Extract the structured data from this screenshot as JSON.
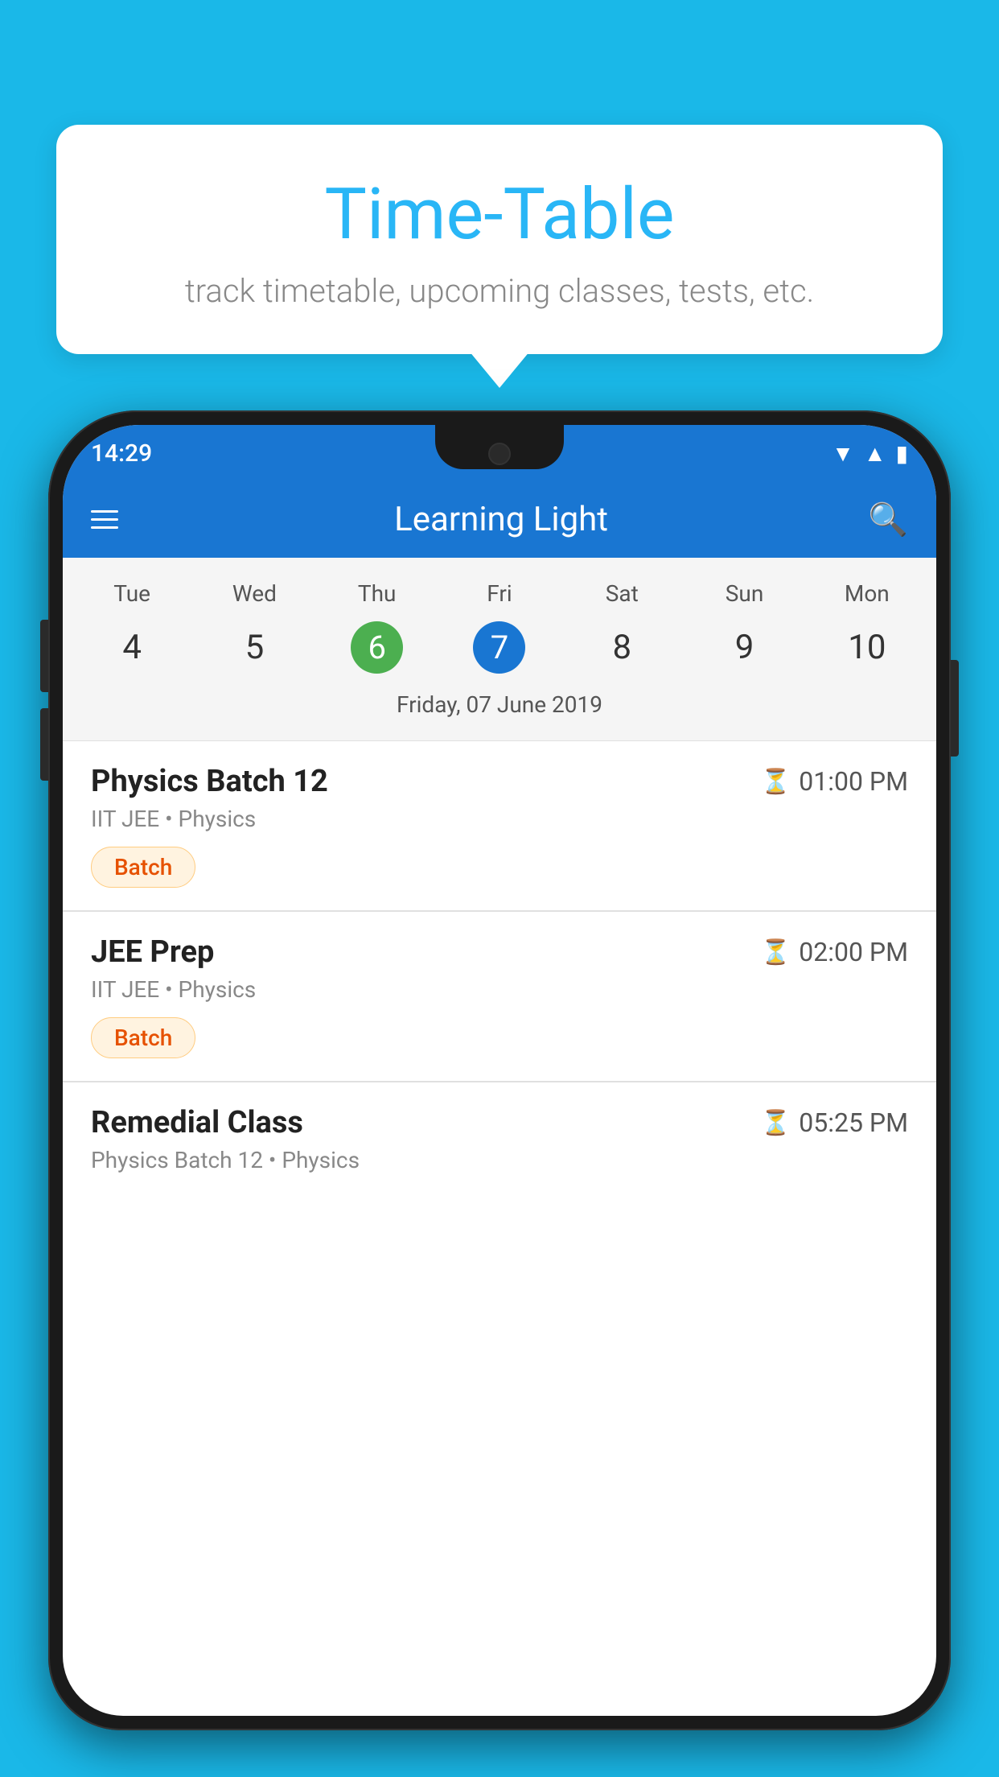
{
  "background_color": "#1ab8e8",
  "tooltip": {
    "title": "Time-Table",
    "subtitle": "track timetable, upcoming classes, tests, etc."
  },
  "phone": {
    "status_bar": {
      "time": "14:29"
    },
    "app_header": {
      "title": "Learning Light"
    },
    "calendar": {
      "days": [
        {
          "label": "Tue",
          "num": "4"
        },
        {
          "label": "Wed",
          "num": "5"
        },
        {
          "label": "Thu",
          "num": "6",
          "state": "today"
        },
        {
          "label": "Fri",
          "num": "7",
          "state": "selected"
        },
        {
          "label": "Sat",
          "num": "8"
        },
        {
          "label": "Sun",
          "num": "9"
        },
        {
          "label": "Mon",
          "num": "10"
        }
      ],
      "selected_date": "Friday, 07 June 2019"
    },
    "classes": [
      {
        "name": "Physics Batch 12",
        "time": "01:00 PM",
        "meta": "IIT JEE • Physics",
        "tag": "Batch"
      },
      {
        "name": "JEE Prep",
        "time": "02:00 PM",
        "meta": "IIT JEE • Physics",
        "tag": "Batch"
      },
      {
        "name": "Remedial Class",
        "time": "05:25 PM",
        "meta": "Physics Batch 12 • Physics",
        "tag": ""
      }
    ]
  }
}
